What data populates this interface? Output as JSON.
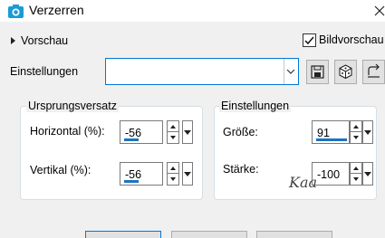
{
  "window": {
    "title": "Verzerren",
    "app_icon": "camera-icon",
    "close_icon": "close-icon"
  },
  "preview": {
    "label": "Vorschau",
    "expand_icon": "triangle-right-icon"
  },
  "image_preview": {
    "label": "Bildvorschau",
    "checked": true
  },
  "presets": {
    "label": "Einstellungen",
    "value": "",
    "tools": [
      "save-icon",
      "dice-icon",
      "reset-icon"
    ]
  },
  "offset_group": {
    "title": "Ursprungsversatz",
    "horizontal": {
      "label": "Horizontal (%):",
      "value": "-56"
    },
    "vertical": {
      "label": "Vertikal (%):",
      "value": "-56"
    }
  },
  "settings_group": {
    "title": "Einstellungen",
    "size": {
      "label": "Größe:",
      "value": "91"
    },
    "strength": {
      "label": "Stärke:",
      "value": "-100"
    }
  },
  "watermark": "Kaa",
  "colors": {
    "accent": "#0078d7",
    "bar": "#1e73be"
  }
}
